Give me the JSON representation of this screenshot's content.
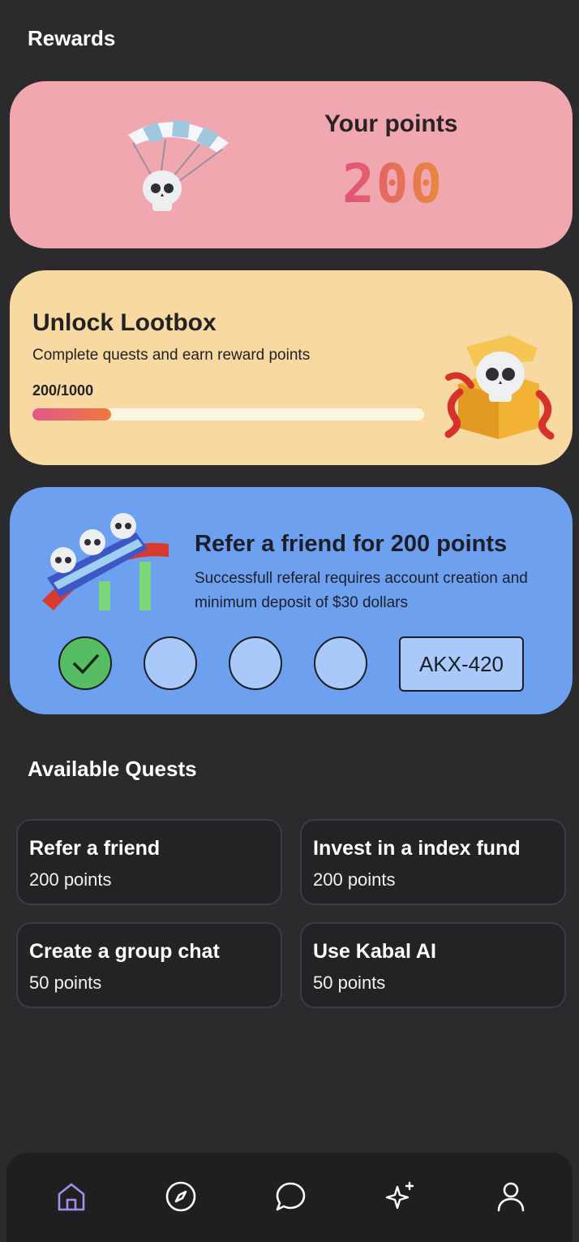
{
  "header": {
    "title": "Rewards"
  },
  "points_card": {
    "label": "Your points",
    "value": "200"
  },
  "lootbox_card": {
    "title": "Unlock Lootbox",
    "subtitle": "Complete quests and earn reward points",
    "progress_text": "200/1000",
    "progress_fraction": 0.2
  },
  "refer_card": {
    "title": "Refer a friend for 200 points",
    "description": "Successfull referal requires account creation and minimum deposit of $30 dollars",
    "steps_completed": 1,
    "steps_total": 4,
    "referral_code": "AKX-420"
  },
  "quests": {
    "title": "Available Quests",
    "items": [
      {
        "name": "Refer a friend",
        "points": "200 points"
      },
      {
        "name": "Invest in a index fund",
        "points": "200 points"
      },
      {
        "name": "Create a group chat",
        "points": "50 points"
      },
      {
        "name": "Use Kabal AI",
        "points": "50 points"
      }
    ]
  },
  "nav": {
    "items": [
      {
        "icon": "home-icon",
        "active": true
      },
      {
        "icon": "compass-icon",
        "active": false
      },
      {
        "icon": "chat-icon",
        "active": false
      },
      {
        "icon": "sparkles-icon",
        "active": false
      },
      {
        "icon": "user-icon",
        "active": false
      }
    ],
    "active_color": "#a58cf0",
    "inactive_color": "#ffffff"
  }
}
